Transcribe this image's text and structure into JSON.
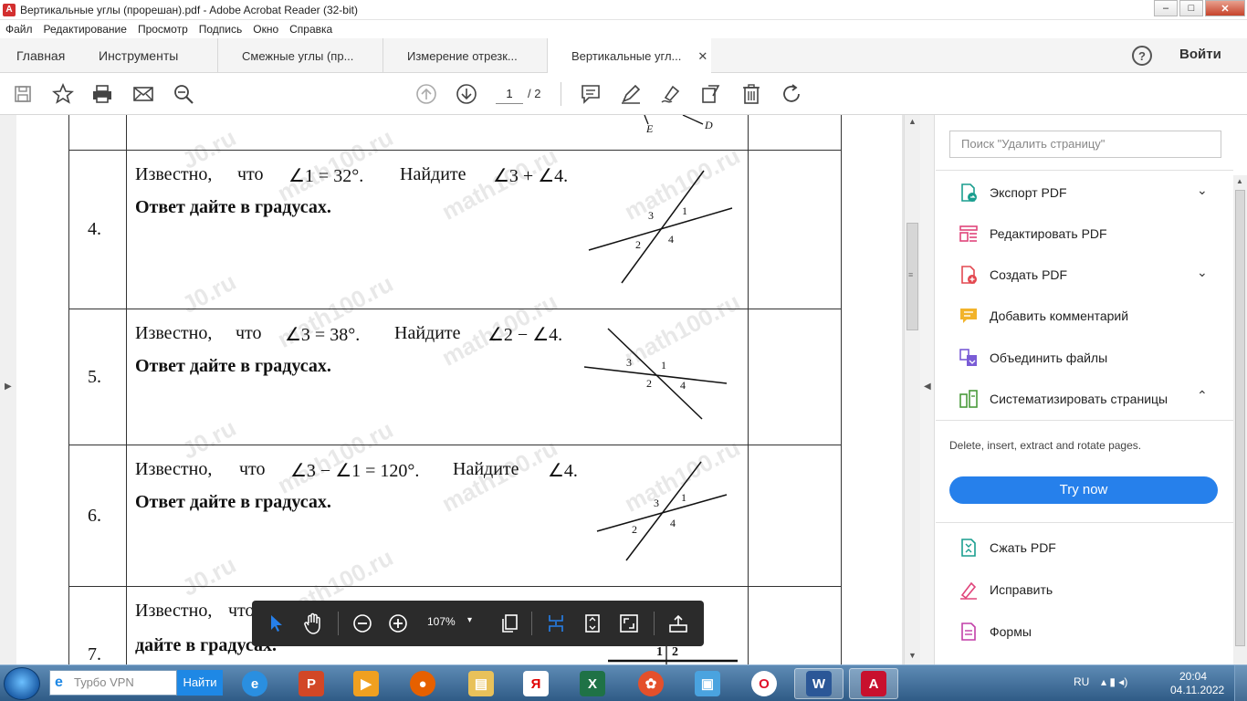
{
  "window": {
    "title": "Вертикальные углы (прорешан).pdf - Adobe Acrobat Reader (32-bit)",
    "controls": {
      "minimize": "–",
      "maximize": "□",
      "close": "✕"
    }
  },
  "menu": [
    "Файл",
    "Редактирование",
    "Просмотр",
    "Подпись",
    "Окно",
    "Справка"
  ],
  "tabs": {
    "home": "Главная",
    "tools": "Инструменты",
    "docs": [
      "Смежные углы (пр...",
      "Измерение отрезк...",
      "Вертикальные угл..."
    ],
    "close_glyph": "✕",
    "help": "?",
    "signin": "Войти"
  },
  "toolbar": {
    "current_page": "1",
    "total_pages": "/ 2"
  },
  "document": {
    "top_labels": {
      "e": "E",
      "d": "D"
    },
    "rows": [
      {
        "num": "4.",
        "line1": [
          "Известно,",
          "что",
          "∠1 = 32°.",
          "Найдите",
          "∠3 + ∠4."
        ],
        "line2": "Ответ дайте в градусах."
      },
      {
        "num": "5.",
        "line1": [
          "Известно,",
          "что",
          "∠3 = 38°.",
          "Найдите",
          "∠2 − ∠4."
        ],
        "line2": "Ответ дайте в градусах."
      },
      {
        "num": "6.",
        "line1": [
          "Известно,",
          "что",
          "∠3 − ∠1 = 120°.",
          "Найдите",
          "∠4."
        ],
        "line2": "Ответ дайте в градусах."
      },
      {
        "num": "7.",
        "line1": [
          "Известно,",
          "что"
        ],
        "line2": "дайте в градусах."
      }
    ],
    "figure_labels": {
      "a1": "1",
      "a2": "2",
      "a3": "3",
      "a4": "4"
    },
    "watermarks": [
      "math100.ru",
      "J0.ru"
    ]
  },
  "float_toolbar": {
    "zoom": "107%",
    "caret": "▾"
  },
  "right_panel": {
    "search_placeholder": "Поиск \"Удалить страницу\"",
    "items_top": [
      {
        "label": "Экспорт PDF",
        "chevron": "⌄"
      },
      {
        "label": "Редактировать PDF"
      },
      {
        "label": "Создать PDF",
        "chevron": "⌄"
      },
      {
        "label": "Добавить комментарий"
      },
      {
        "label": "Объединить файлы"
      },
      {
        "label": "Систематизировать страницы",
        "chevron": "⌃"
      }
    ],
    "description": "Delete, insert, extract and rotate pages.",
    "try_now": "Try now",
    "items_bottom": [
      {
        "label": "Сжать PDF"
      },
      {
        "label": "Исправить"
      },
      {
        "label": "Формы"
      }
    ],
    "colors": {
      "accent": "#2680eb"
    }
  },
  "taskbar": {
    "search_placeholder": "Турбо VPN",
    "search_button": "Найти",
    "language": "RU",
    "time": "20:04",
    "date": "04.11.2022"
  }
}
